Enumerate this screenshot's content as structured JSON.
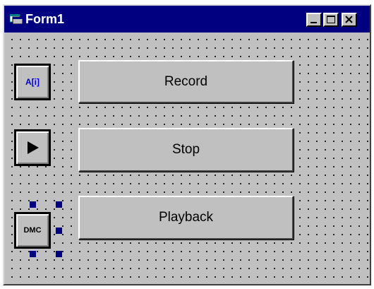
{
  "window": {
    "title": "Form1"
  },
  "titlebar": {
    "buttons": [
      "minimize",
      "maximize",
      "close"
    ]
  },
  "controls": {
    "array_icon_label": "A[i]",
    "play_icon": "play-icon",
    "dmc_label": "DMC"
  },
  "buttons": {
    "record": "Record",
    "stop": "Stop",
    "playback": "Playback"
  },
  "colors": {
    "title_bar": "#000080",
    "face": "#c0c0c0",
    "selection_handles": "#000080",
    "array_label": "#0000cc"
  }
}
